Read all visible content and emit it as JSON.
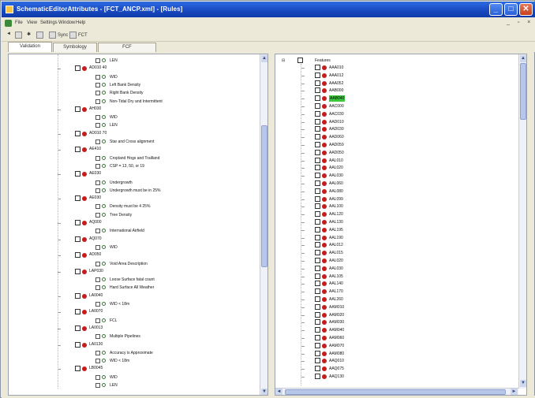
{
  "window": {
    "title": "SchematicEditorAttributes - [FCT_ANCP.xml] - [Rules]"
  },
  "menu": [
    "File",
    "View",
    "Settings",
    "Window",
    "Help"
  ],
  "toolbar": {
    "item1": "Sync",
    "item2": "FCT"
  },
  "tabs": [
    "Validation",
    "Symbology",
    "FCF"
  ],
  "left_tree": {
    "items": [
      {
        "type": "leaf",
        "label": "LEN"
      },
      {
        "type": "feature",
        "label": "AD010 40"
      },
      {
        "type": "leaf",
        "label": "WID"
      },
      {
        "type": "leaf",
        "label": "Left Bank Density"
      },
      {
        "type": "leaf",
        "label": "Right Bank Density"
      },
      {
        "type": "leaf",
        "label": "Non-Tidal Dry and Intermittent"
      },
      {
        "type": "feature",
        "label": "AH030"
      },
      {
        "type": "leaf",
        "label": "WID"
      },
      {
        "type": "leaf",
        "label": "LEN"
      },
      {
        "type": "feature",
        "label": "AD010 70"
      },
      {
        "type": "leaf",
        "label": "Star and Cross alignment"
      },
      {
        "type": "feature",
        "label": "AE410"
      },
      {
        "type": "leaf",
        "label": "Cropland Hogs and Trailland"
      },
      {
        "type": "leaf",
        "label": "CSP = 13, 50, or 19"
      },
      {
        "type": "feature",
        "label": "AE030"
      },
      {
        "type": "leaf",
        "label": "Undergrowth"
      },
      {
        "type": "leaf",
        "label": "Undergrowth must be in 25%"
      },
      {
        "type": "feature",
        "label": "AE030"
      },
      {
        "type": "leaf",
        "label": "Density must be 4 25%"
      },
      {
        "type": "leaf",
        "label": "Tree Density"
      },
      {
        "type": "feature",
        "label": "AQ000"
      },
      {
        "type": "leaf",
        "label": "International Airfield"
      },
      {
        "type": "feature",
        "label": "AQ070"
      },
      {
        "type": "leaf",
        "label": "WID"
      },
      {
        "type": "feature",
        "label": "AD050"
      },
      {
        "type": "leaf",
        "label": "Void Area Description"
      },
      {
        "type": "feature",
        "label": "LAP030"
      },
      {
        "type": "leaf",
        "label": "Loose Surface fatal count"
      },
      {
        "type": "leaf",
        "label": "Hard Surface All Weather"
      },
      {
        "type": "feature",
        "label": "LA0040"
      },
      {
        "type": "leaf",
        "label": "WID < 18m"
      },
      {
        "type": "feature",
        "label": "LA0070"
      },
      {
        "type": "leaf",
        "label": "FCL"
      },
      {
        "type": "feature",
        "label": "LA0013"
      },
      {
        "type": "leaf",
        "label": "Multiple Pipelines"
      },
      {
        "type": "feature",
        "label": "LA0130"
      },
      {
        "type": "leaf",
        "label": "Accuracy is Approximate"
      },
      {
        "type": "leaf",
        "label": "WID < 18m"
      },
      {
        "type": "feature",
        "label": "LB0045"
      },
      {
        "type": "leaf",
        "label": "WID"
      },
      {
        "type": "leaf",
        "label": "LEN"
      }
    ]
  },
  "right_tree": {
    "root": "Features",
    "items": [
      "AAA010",
      "AAA012",
      "AAA052",
      "AAB000",
      "AAB040",
      "AAC000",
      "AAC030",
      "AAD010",
      "AAD030",
      "AAD060",
      "AAD059",
      "AAD050",
      "AAL010",
      "AAL020",
      "AAL030",
      "AAL060",
      "AAL080",
      "AAL099",
      "AAL100",
      "AAL120",
      "AAL130",
      "AAL195",
      "AAL190",
      "AAL012",
      "AAL015",
      "AAL020",
      "AAL030",
      "AAL105",
      "AAL140",
      "AAL170",
      "AAL260",
      "AAM010",
      "AAM020",
      "AAM030",
      "AAM040",
      "AAM060",
      "AAM070",
      "AAM080",
      "AAQ010",
      "AAQ075",
      "AAQ130"
    ],
    "selected_index": 4
  }
}
